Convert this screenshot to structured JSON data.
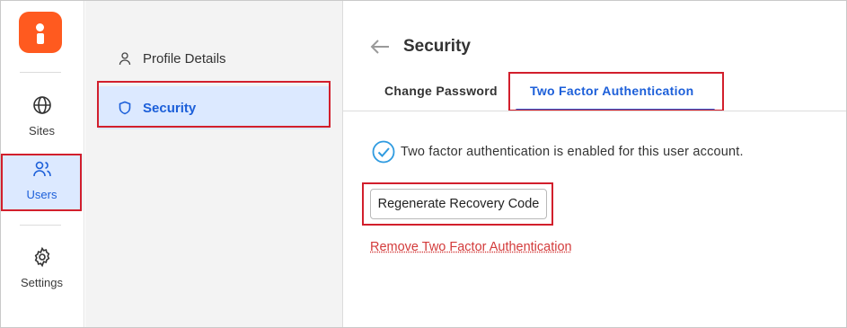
{
  "rail": {
    "items": [
      {
        "label": "Sites",
        "icon": "globe-icon"
      },
      {
        "label": "Users",
        "icon": "users-icon"
      },
      {
        "label": "Settings",
        "icon": "gear-icon"
      }
    ]
  },
  "sidebar": {
    "items": [
      {
        "label": "Profile Details",
        "icon": "person-icon"
      },
      {
        "label": "Security",
        "icon": "shield-icon"
      }
    ]
  },
  "main": {
    "title": "Security",
    "tabs": [
      {
        "label": "Change Password"
      },
      {
        "label": "Two Factor Authentication"
      }
    ],
    "status_text": "Two factor authentication is enabled for this user account.",
    "regen_button": "Regenerate Recovery Code",
    "remove_link": "Remove Two Factor Authentication"
  },
  "colors": {
    "brand": "#ff5a1f",
    "accent": "#1c5fd9",
    "active_bg": "#dce9ff",
    "highlight": "#d21f2c",
    "danger": "#d33b3b",
    "success": "#2f9be0"
  }
}
